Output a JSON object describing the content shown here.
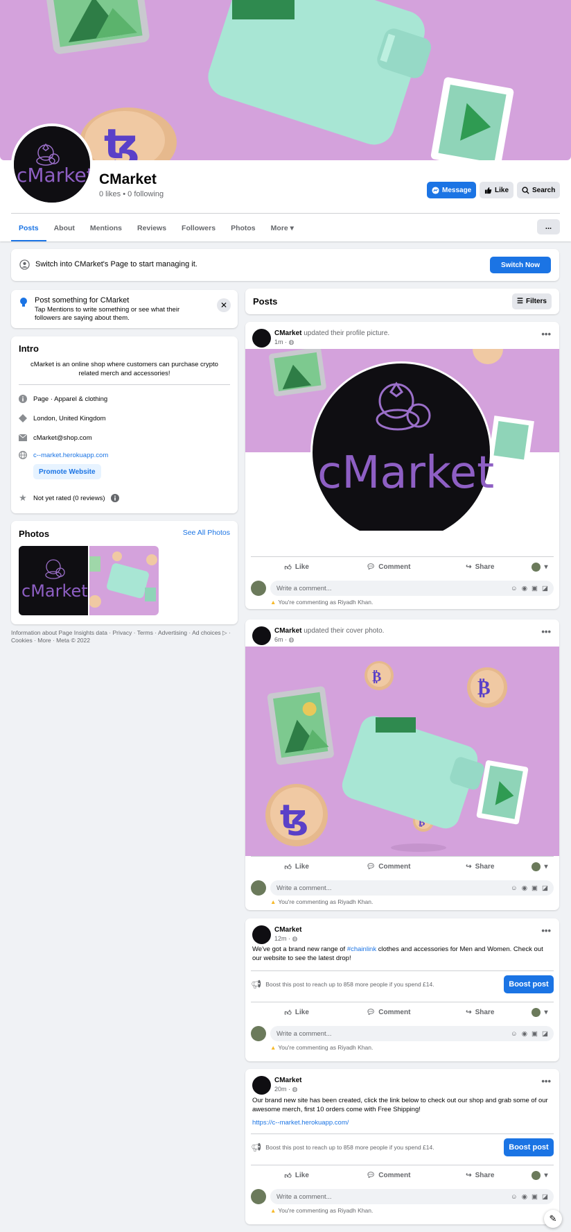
{
  "page": {
    "name": "CMarket",
    "stats": "0 likes • 0 following",
    "avatar_text": "cMarket"
  },
  "header_buttons": {
    "message": "Message",
    "like": "Like",
    "search": "Search",
    "more": "..."
  },
  "tabs": [
    "Posts",
    "About",
    "Mentions",
    "Reviews",
    "Followers",
    "Photos",
    "More"
  ],
  "switch": {
    "text": "Switch into CMarket's Page to start managing it.",
    "button": "Switch Now"
  },
  "tip": {
    "title": "Post something for CMarket",
    "body": "Tap Mentions to write something or see what their followers are saying about them."
  },
  "intro": {
    "title": "Intro",
    "description": "cMarket is an online shop where customers can purchase crypto related merch and accessories!",
    "category": "Page · Apparel & clothing",
    "location": "London, United Kingdom",
    "email": "cMarket@shop.com",
    "website": "c--market.herokuapp.com",
    "promote": "Promote Website",
    "rating": "Not yet rated (0 reviews)"
  },
  "photos": {
    "title": "Photos",
    "see_all": "See All Photos"
  },
  "footer": "Information about Page Insights data · Privacy · Terms · Advertising · Ad choices ▷ · Cookies · More · Meta © 2022",
  "posts_header": {
    "title": "Posts",
    "filters": "Filters"
  },
  "actions": {
    "like": "Like",
    "comment": "Comment",
    "share": "Share"
  },
  "comment": {
    "placeholder": "Write a comment...",
    "warning": "You're commenting as Riyadh Khan."
  },
  "boost": {
    "text": "Boost this post to reach up to 858 more people if you spend £14.",
    "button": "Boost post"
  },
  "posts": [
    {
      "name": "CMarket",
      "action": "updated their profile picture.",
      "time": "1m ·"
    },
    {
      "name": "CMarket",
      "action": "updated their cover photo.",
      "time": "6m ·"
    },
    {
      "name": "CMarket",
      "action": "",
      "time": "12m ·",
      "text_before": "We've got a brand new range of ",
      "hashtag": "#chainlink",
      "text_after": " clothes and accessories for Men and Women. Check out our website to see the latest drop!"
    },
    {
      "name": "CMarket",
      "action": "",
      "time": "20m ·",
      "text": "Our brand new site has been created, click the link below to check out our shop and grab some of our awesome merch, first 10 orders come with Free Shipping!",
      "link": "https://c--market.herokuapp.com/"
    }
  ],
  "colors": {
    "accent": "#1b74e4",
    "cover_bg": "#d4a2dc",
    "logo_purple": "#9b6fc9",
    "avatar_bg": "#0f0e12"
  }
}
